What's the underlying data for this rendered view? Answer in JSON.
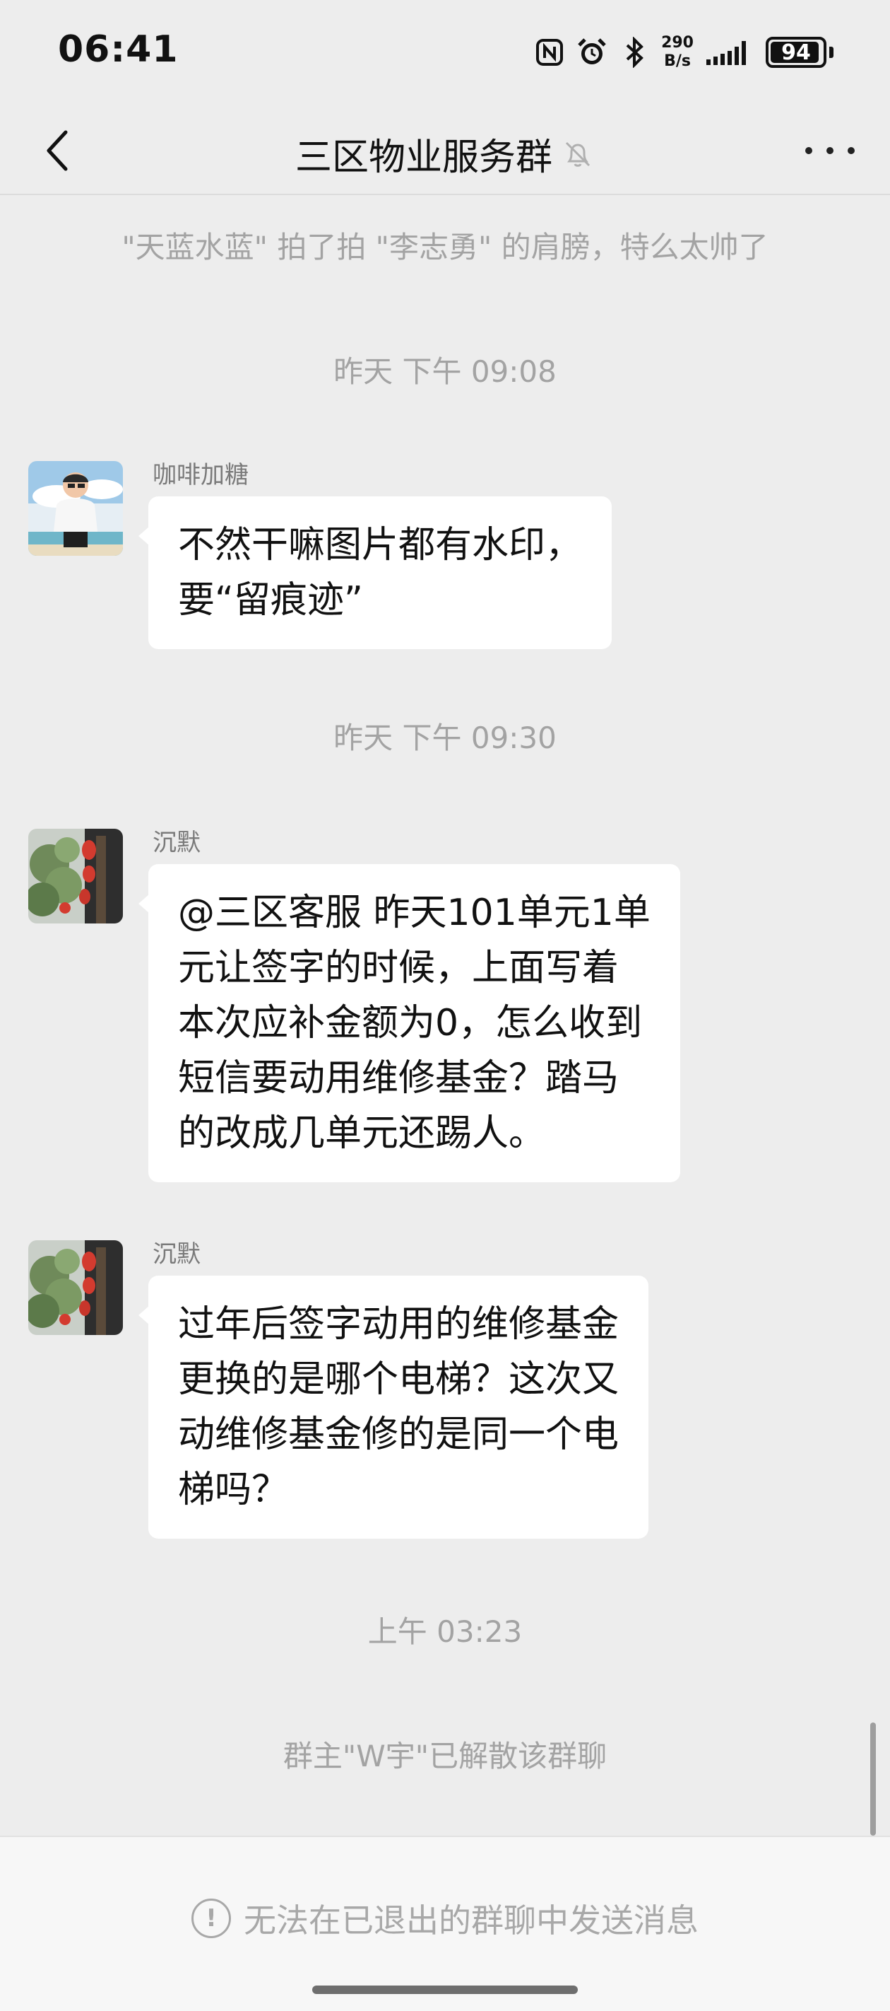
{
  "status_bar": {
    "time": "06:41",
    "net_speed_value": "290",
    "net_speed_unit": "B/s",
    "battery": "94",
    "battery_level": 0.94
  },
  "header": {
    "title": "三区物业服务群",
    "back_icon": "chevron-left-icon",
    "mute_icon": "bell-off-icon",
    "more_icon": "more-dots-icon"
  },
  "chat": {
    "system_pat": "\"天蓝水蓝\" 拍了拍 \"李志勇\" 的肩膀，特么太帅了",
    "time_1": "昨天 下午 09:08",
    "time_2": "昨天 下午 09:30",
    "time_3": "上午 03:23",
    "system_dissolve": "群主\"W宇\"已解散该群聊",
    "messages": [
      {
        "sender": "咖啡加糖",
        "lines": [
          "不然干嘛图片都有水印，",
          "要“留痕迹”"
        ]
      },
      {
        "sender": "沉默",
        "lines": [
          "@三区客服 昨天101单元1单",
          "元让签字的时候，上面写着",
          "本次应补金额为0，怎么收到",
          "短信要动用维修基金？踏马",
          "的改成几单元还踢人。"
        ]
      },
      {
        "sender": "沉默",
        "lines": [
          "过年后签字动用的维修基金",
          "更换的是哪个电梯？这次又",
          "动维修基金修的是同一个电",
          "梯吗？"
        ]
      }
    ]
  },
  "footer": {
    "notice": "无法在已退出的群聊中发送消息",
    "notice_icon": "exclamation-circle-icon"
  }
}
